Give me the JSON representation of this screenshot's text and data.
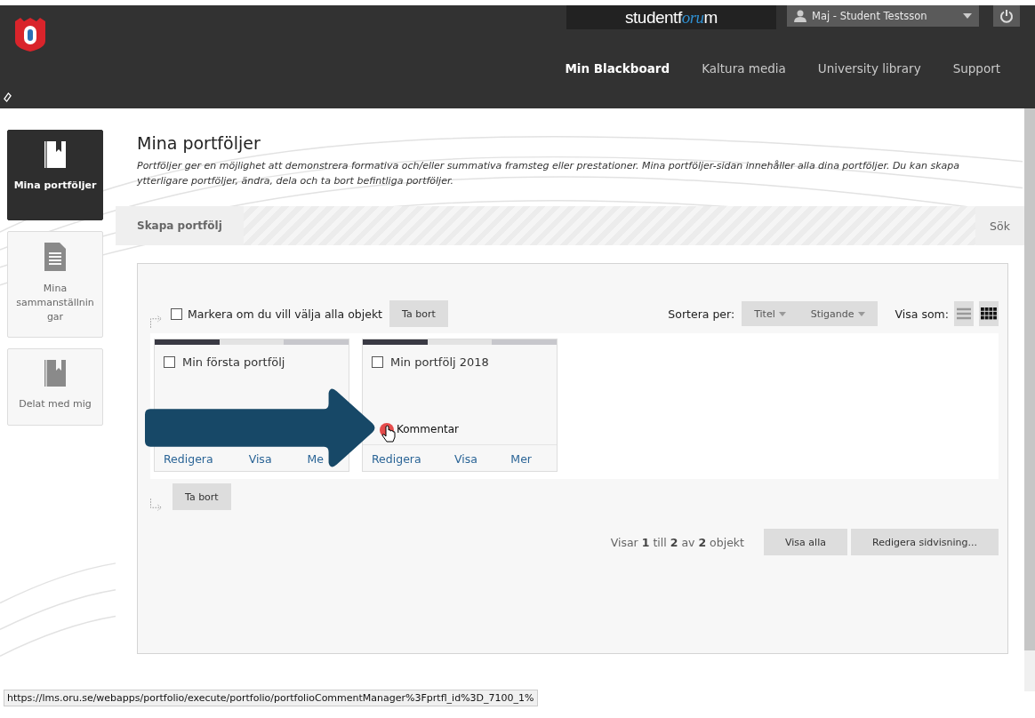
{
  "header": {
    "logo_parts": [
      {
        "text": "studentf",
        "kind": "plain"
      },
      {
        "text": "oru",
        "kind": "accent"
      },
      {
        "text": "m",
        "kind": "plain"
      }
    ],
    "user": "Maj - Student Testsson",
    "nav": [
      {
        "label": "Min Blackboard",
        "selected": true
      },
      {
        "label": "Kaltura media",
        "selected": false
      },
      {
        "label": "University library",
        "selected": false
      },
      {
        "label": "Support",
        "selected": false
      }
    ]
  },
  "sidebar": {
    "items": [
      {
        "label": "Mina portföljer",
        "kind": "book",
        "selected": true
      },
      {
        "label": "Mina sammanställningar",
        "kind": "document",
        "selected": false
      },
      {
        "label": "Delat med mig",
        "kind": "book",
        "selected": false
      }
    ]
  },
  "page": {
    "title": "Mina portföljer",
    "description": "Portföljer ger en möjlighet att demonstrera formativa och/eller summativa framsteg eller prestationer. Mina portföljer-sidan innehåller alla dina portföljer. Du kan skapa ytterligare portföljer, ändra, dela och ta bort befintliga portföljer."
  },
  "action_bar": {
    "create": "Skapa portfölj",
    "search": "Sök"
  },
  "list": {
    "select_all": {
      "label": "Markera om du vill välja alla objekt",
      "checked": false
    },
    "delete_top": "Ta bort",
    "sort_label": "Sortera per:",
    "sort_options": [
      "Titel",
      "Stigande"
    ],
    "view_label": "Visa som:",
    "view_modes": [
      {
        "kind": "list",
        "selected": false
      },
      {
        "kind": "grid",
        "selected": true
      }
    ],
    "delete_bottom": "Ta bort"
  },
  "cards": [
    {
      "title": "Min första portfölj",
      "checked": false,
      "actions": [
        "Redigera",
        "Visa",
        "Me"
      ]
    },
    {
      "title": "Min portfölj 2018",
      "checked": false,
      "hover_link": "Kommentar",
      "actions": [
        "Redigera",
        "Visa",
        "Mer"
      ]
    }
  ],
  "pagination": {
    "summary": "Visar **1** till **2** av **2** objekt",
    "buttons": [
      "Visa alla",
      "Redigera sidvisning..."
    ]
  },
  "status_url": "https://lms.oru.se/webapps/portfolio/execute/portfolio/portfolioCommentManager%3Fprtfl_id%3D_7100_1%"
}
